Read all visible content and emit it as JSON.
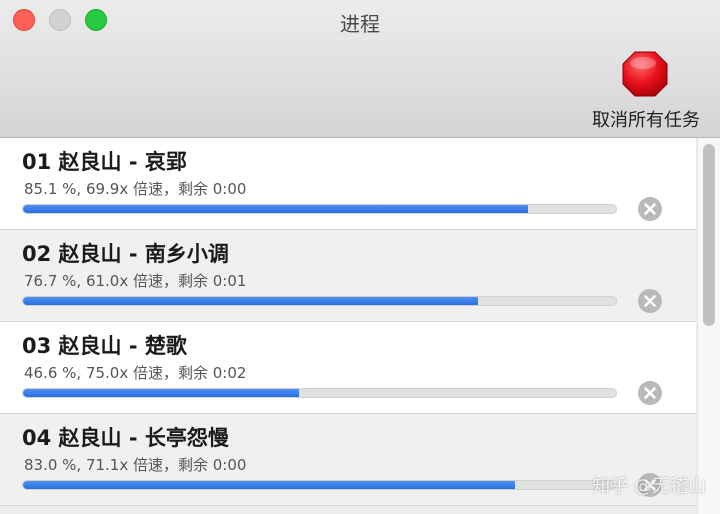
{
  "window": {
    "title": "进程"
  },
  "toolbar": {
    "cancel_all_label": "取消所有任务",
    "cancel_all_icon": "stop-sign-icon",
    "stop_color": "#e8101c"
  },
  "tasks": [
    {
      "title": "01 赵良山 - 哀郢",
      "status": "85.1 %, 69.9x 倍速，剩余 0:00",
      "progress_percent": 85.1
    },
    {
      "title": "02 赵良山 - 南乡小调",
      "status": "76.7 %, 61.0x 倍速，剩余 0:01",
      "progress_percent": 76.7
    },
    {
      "title": "03 赵良山 - 楚歌",
      "status": "46.6 %, 75.0x 倍速，剩余 0:02",
      "progress_percent": 46.6
    },
    {
      "title": "04 赵良山 - 长亭怨慢",
      "status": "83.0 %, 71.1x 倍速，剩余 0:00",
      "progress_percent": 83.0
    }
  ],
  "colors": {
    "progress_fill": "#2a6fe0",
    "progress_track": "#e1e1e1"
  },
  "watermark": "知乎 @无稽山"
}
